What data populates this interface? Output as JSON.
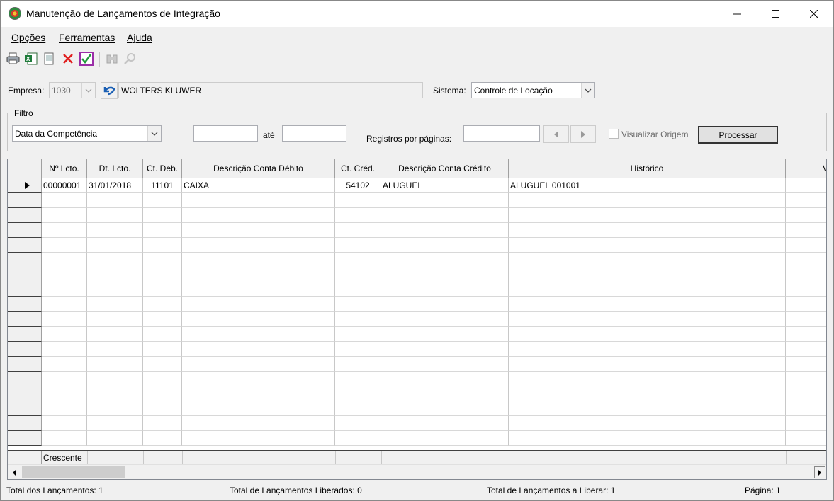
{
  "window": {
    "title": "Manutenção de Lançamentos de Integração"
  },
  "menu": {
    "items": [
      "Opções",
      "Ferramentas",
      "Ajuda"
    ]
  },
  "toolbar": {
    "icons": [
      "print-icon",
      "export-excel-icon",
      "document-icon",
      "delete-icon",
      "confirm-icon",
      "binoculars-icon",
      "search-icon"
    ]
  },
  "empresa": {
    "label": "Empresa:",
    "code": "1030",
    "name": "WOLTERS KLUWER"
  },
  "sistema": {
    "label": "Sistema:",
    "value": "Controle de Locação"
  },
  "filtro": {
    "legend": "Filtro",
    "field": "Data da Competência",
    "from": "",
    "ate_label": "até",
    "to": "",
    "registros_label": "Registros por páginas:",
    "registros_value": "",
    "visualizar_label": "Visualizar Origem",
    "processar_label": "Processar"
  },
  "grid": {
    "columns": [
      "Nº Lcto.",
      "Dt. Lcto.",
      "Ct. Deb.",
      "Descrição Conta Débito",
      "Ct. Créd.",
      "Descrição Conta Crédito",
      "Histórico",
      "V"
    ],
    "rows": [
      {
        "numero": "00000001",
        "data": "31/01/2018",
        "ct_deb": "11101",
        "desc_debito": "CAIXA",
        "ct_cred": "54102",
        "desc_credito": "ALUGUEL",
        "historico": "ALUGUEL 001001"
      }
    ],
    "footer": "Crescente"
  },
  "status": {
    "total": "Total dos Lançamentos: 1",
    "liberados": "Total de Lançamentos Liberados: 0",
    "a_liberar": "Total de Lançamentos a Liberar: 1",
    "pagina": "Página: 1"
  }
}
